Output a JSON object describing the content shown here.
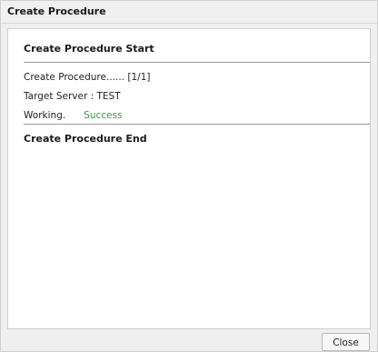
{
  "dialog": {
    "title": "Create Procedure"
  },
  "log": {
    "start_heading": "Create Procedure Start",
    "line_progress": "Create Procedure...... [1/1]",
    "line_target": "Target Server : TEST",
    "line_working_label": "Working.",
    "line_working_status": "Success",
    "end_heading": "Create Procedure End"
  },
  "colors": {
    "success": "#2ca02c",
    "divider": "#9a9a9a"
  },
  "footer": {
    "close_label": "Close"
  }
}
